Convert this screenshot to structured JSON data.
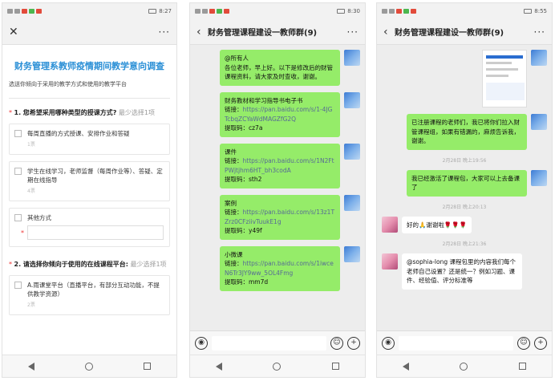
{
  "phone1": {
    "time": "8:27",
    "battery": "73",
    "title": "财务管理系教师疫情期间教学意向调查",
    "subtitle": "选送你倾向于采用的教学方式和使用的教学平台",
    "q1": {
      "req": "*",
      "num": "1.",
      "text": "您希望采用哪种类型的授课方式?",
      "hint": "最少选择1项",
      "options": [
        {
          "label": "每周直播的方式授课、安排作业和答疑",
          "count": "1票"
        },
        {
          "label": "学生在线学习，老师监督（每周作业等）、答疑、定期在线指导",
          "count": "4票"
        },
        {
          "label": "其他方式",
          "count": ""
        }
      ],
      "other_required": "*"
    },
    "q2": {
      "req": "*",
      "num": "2.",
      "text": "请选择你倾向于使用的在线课程平台:",
      "hint": "最少选择1项",
      "options": [
        {
          "label": "A.雨课堂平台（直播平台，有部分互动功能，不提供教学资源）",
          "count": "2票"
        }
      ]
    }
  },
  "phone2": {
    "time": "8:30",
    "title": "财务管理课程建设一教师群(9)",
    "messages": [
      {
        "lines": [
          "@所有人",
          "各位老师，早上好。以下是修改后的财管课程资料，请大家及时查收，谢谢。"
        ]
      },
      {
        "lines": [
          "财务教材和学习指导书电子书"
        ],
        "link_label": "链接：",
        "link": "https://pan.baidu.com/s/1-4JGTcbqZCYaWdMAGZfG2Q",
        "code": "提取码：cz7a"
      },
      {
        "lines": [
          "课件"
        ],
        "link_label": "链接：",
        "link": "https://pan.baidu.com/s/1N2FtPWjtjhm6HT_bh3codA",
        "code": "提取码：sth2"
      },
      {
        "lines": [
          "案例"
        ],
        "link_label": "链接：",
        "link": "https://pan.baidu.com/s/13z1TZrz0CFziivTuukE1g",
        "code": "提取码：y49f"
      },
      {
        "lines": [
          "小微课"
        ],
        "link_label": "链接：",
        "link": "https://pan.baidu.com/s/1iwceN6Tr3JY9ww_5OL4Fmg",
        "code": "提取码：mm7d"
      }
    ]
  },
  "phone3": {
    "time": "8:55",
    "title": "财务管理课程建设一教师群(9)",
    "msg1": "已注册课程的老师们，我已将你们拉入财管课程组，如果有错漏的，麻烦告诉我，谢谢。",
    "time1": "2月28日 晚上19:56",
    "msg2": "我已经激活了课程包，大家可以上去备课了",
    "time2": "2月28日 晚上20:13",
    "msg3": "好的🙏谢谢啦🌹🌹🌹",
    "time3": "2月28日 晚上21:36",
    "msg4": "@sophia-long 课程包里的内容我们每个老师自己设置？还是统一？例如习题、课件、经验值、评分标准等"
  },
  "icons": {
    "more": "···",
    "close": "✕",
    "back": "‹",
    "voice": "◉",
    "emoji": "☺",
    "plus": "+"
  }
}
